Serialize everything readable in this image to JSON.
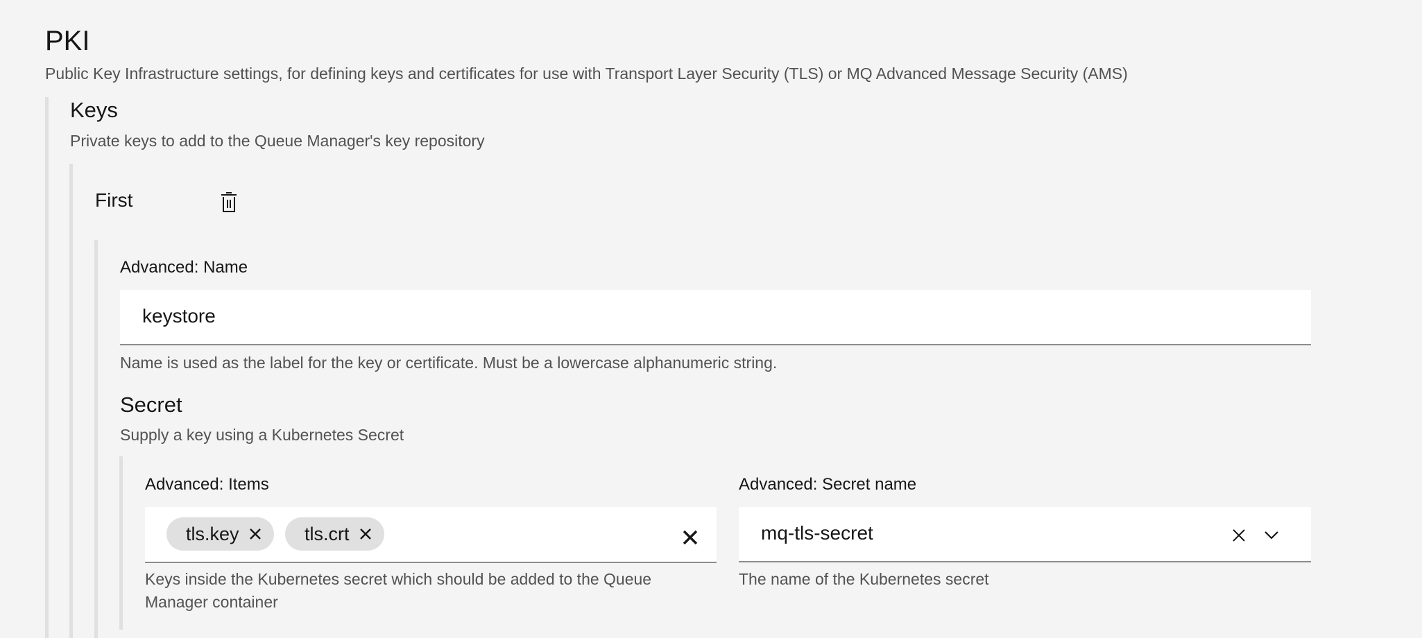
{
  "pki": {
    "title": "PKI",
    "description": "Public Key Infrastructure settings, for defining keys and certificates for use with Transport Layer Security (TLS) or MQ Advanced Message Security (AMS)"
  },
  "keys": {
    "title": "Keys",
    "description": "Private keys to add to the Queue Manager's key repository",
    "item": {
      "title": "First",
      "delete_icon": "trash-icon",
      "name_field": {
        "label": "Advanced: Name",
        "value": "keystore",
        "helper": "Name is used as the label for the key or certificate. Must be a lowercase alphanumeric string."
      },
      "secret": {
        "title": "Secret",
        "description": "Supply a key using a Kubernetes Secret",
        "items_field": {
          "label": "Advanced: Items",
          "tags": [
            "tls.key",
            "tls.crt"
          ],
          "helper_line1": "Keys inside the Kubernetes secret which should be added to the Queue",
          "helper_line2": "Manager container"
        },
        "secret_name_field": {
          "label": "Advanced: Secret name",
          "value": "mq-tls-secret",
          "helper": "The name of the Kubernetes secret"
        }
      }
    }
  },
  "colors": {
    "background": "#f4f4f4",
    "field": "#ffffff",
    "rail": "#e0e0e0",
    "tag": "#e0e0e0",
    "text": "#161616",
    "helper": "#525252"
  }
}
